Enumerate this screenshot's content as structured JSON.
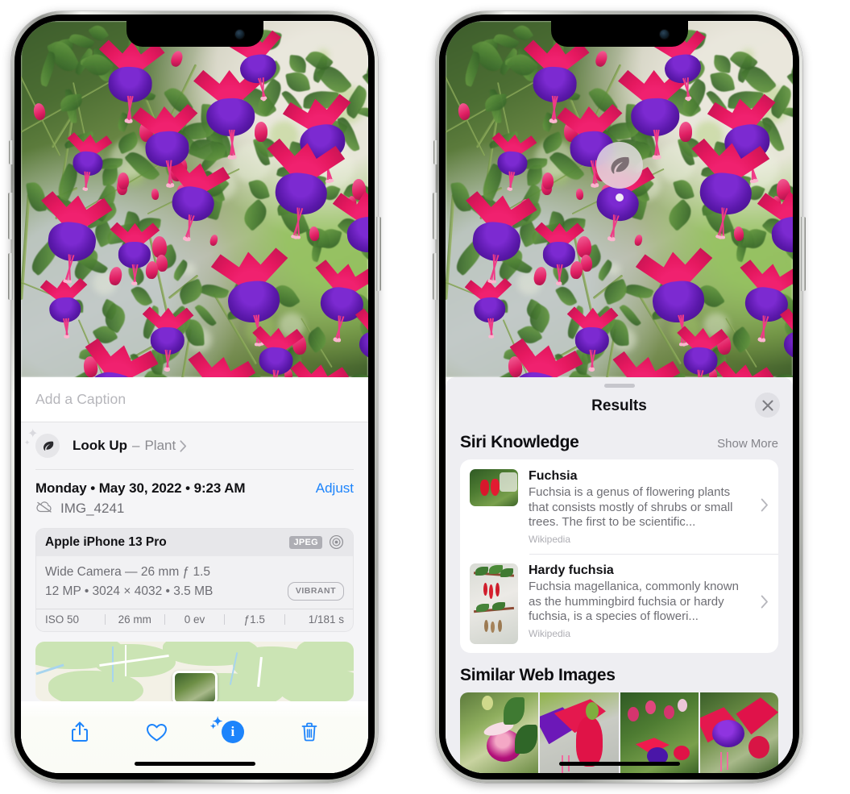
{
  "left_phone": {
    "name": "iphone-photos-info-view",
    "caption_field": {
      "placeholder": "Add a Caption",
      "value": ""
    },
    "lookup": {
      "icon": "leaf-icon",
      "title": "Look Up",
      "dash": "–",
      "subject": "Plant",
      "chevron": "chevron-right-icon"
    },
    "date_row": {
      "date": "Monday • May 30, 2022 • 9:23 AM",
      "adjust_label": "Adjust"
    },
    "file_row": {
      "icon": "icloud-slash-icon",
      "filename": "IMG_4241"
    },
    "camera_card": {
      "model": "Apple iPhone 13 Pro",
      "format_tag": "JPEG",
      "aperture_icon": "aperture-icon",
      "lens_line": "Wide Camera — 26 mm ƒ 1.5",
      "specs_line": "12 MP • 3024 × 4032 • 3.5 MB",
      "style_tag": "VIBRANT",
      "exif": [
        {
          "label": "ISO 50"
        },
        {
          "label": "26 mm"
        },
        {
          "label": "0 ev"
        },
        {
          "label": "ƒ1.5"
        },
        {
          "label": "1/181 s"
        }
      ]
    },
    "map": {
      "name": "location-map",
      "pin": "photo-thumbnail-pin"
    },
    "toolbar": [
      {
        "name": "share-button",
        "icon": "share-icon"
      },
      {
        "name": "favorite-button",
        "icon": "heart-icon"
      },
      {
        "name": "info-button",
        "icon": "info-sparkle-icon",
        "glyph": "i"
      },
      {
        "name": "delete-button",
        "icon": "trash-icon"
      }
    ]
  },
  "right_phone": {
    "name": "iphone-visual-lookup-results",
    "photo_badge": {
      "icon": "leaf-icon",
      "name": "visual-lookup-leaf-badge"
    },
    "sheet": {
      "grabber": "sheet-grabber",
      "title": "Results",
      "close_icon": "close-icon"
    },
    "siri_knowledge": {
      "heading": "Siri Knowledge",
      "show_more": "Show More",
      "items": [
        {
          "name": "Fuchsia",
          "description": "Fuchsia is a genus of flowering plants that consists mostly of shrubs or small trees. The first to be scientific...",
          "source": "Wikipedia",
          "chevron": "chevron-right-icon"
        },
        {
          "name": "Hardy fuchsia",
          "description": "Fuchsia magellanica, commonly known as the hummingbird fuchsia or hardy fuchsia, is a species of floweri...",
          "source": "Wikipedia",
          "chevron": "chevron-right-icon"
        }
      ]
    },
    "similar_web_images": {
      "heading": "Similar Web Images",
      "items": [
        {
          "name": "similar-image-1"
        },
        {
          "name": "similar-image-2"
        },
        {
          "name": "similar-image-3"
        },
        {
          "name": "similar-image-4"
        }
      ]
    }
  },
  "colors": {
    "accent_blue": "#1d84fb",
    "sheet_bg": "#eeeef2",
    "card_bg": "#ffffff",
    "text_primary": "#111114",
    "text_secondary": "#6e6e74",
    "text_tertiary": "#aeaeb4"
  }
}
